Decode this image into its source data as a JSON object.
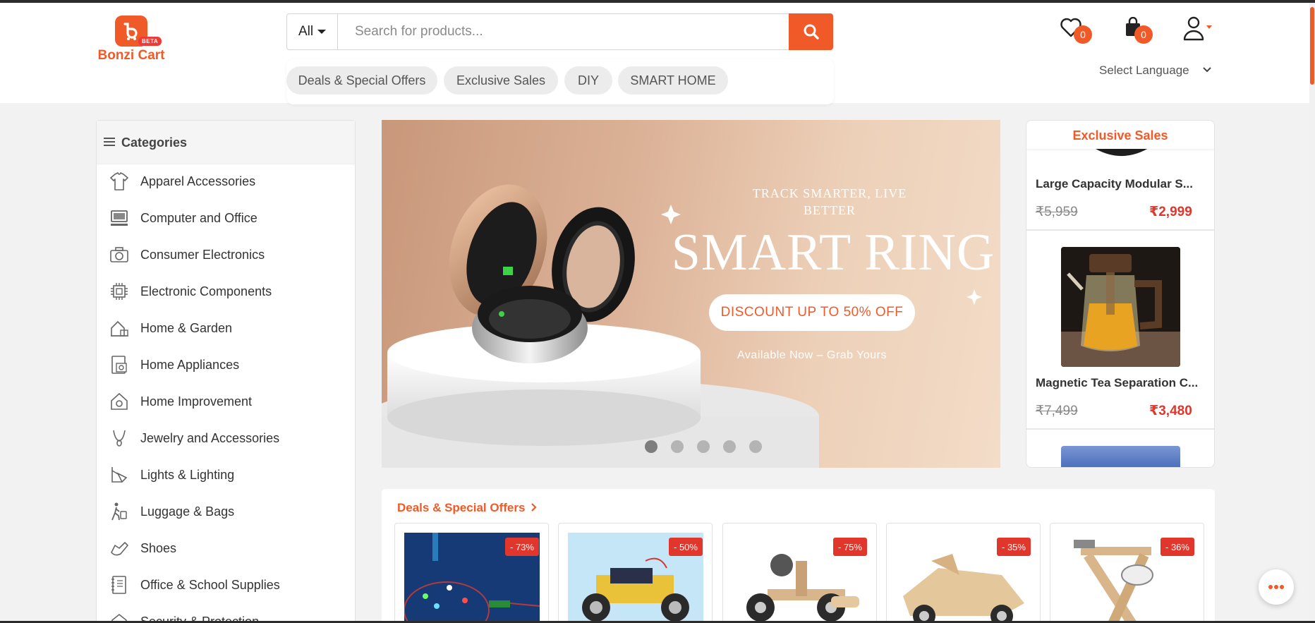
{
  "brand": {
    "name": "Bonzi Cart",
    "tag": "BETA",
    "logo_letter": "b",
    "accent": "#f05a28",
    "price_color": "#e0362c"
  },
  "search": {
    "category": "All",
    "placeholder": "Search for products..."
  },
  "quick_links": [
    "Deals & Special Offers",
    "Exclusive Sales",
    "DIY",
    "SMART HOME"
  ],
  "header": {
    "wishlist_count": "0",
    "cart_count": "0",
    "language_label": "Select Language"
  },
  "sidebar": {
    "title": "Categories",
    "items": [
      {
        "label": "Apparel Accessories",
        "icon": "shirt-icon"
      },
      {
        "label": "Computer and Office",
        "icon": "computer-icon"
      },
      {
        "label": "Consumer Electronics",
        "icon": "camera-icon"
      },
      {
        "label": "Electronic Components",
        "icon": "chip-icon"
      },
      {
        "label": "Home & Garden",
        "icon": "house-icon"
      },
      {
        "label": "Home Appliances",
        "icon": "appliance-icon"
      },
      {
        "label": "Home Improvement",
        "icon": "home-gear-icon"
      },
      {
        "label": "Jewelry and Accessories",
        "icon": "necklace-icon"
      },
      {
        "label": "Lights & Lighting",
        "icon": "lamp-icon"
      },
      {
        "label": "Luggage & Bags",
        "icon": "traveler-icon"
      },
      {
        "label": "Shoes",
        "icon": "shoe-icon"
      },
      {
        "label": "Office & School Supplies",
        "icon": "binder-icon"
      },
      {
        "label": "Security & Protection",
        "icon": "lock-icon"
      }
    ]
  },
  "banner": {
    "subtitle": "TRACK SMARTER, LIVE BETTER",
    "title": "SMART RING",
    "cta": "DISCOUNT UP TO 50% OFF",
    "footer": "Available Now – Grab Yours",
    "slide_count": 5,
    "active_slide": 1
  },
  "exclusive": {
    "title": "Exclusive Sales",
    "items": [
      {
        "name": "Large Capacity Modular S...",
        "old_price": "₹5,959",
        "price": "₹2,999"
      },
      {
        "name": "Magnetic Tea Separation C...",
        "old_price": "₹7,499",
        "price": "₹3,480"
      }
    ]
  },
  "deals": {
    "title": "Deals & Special Offers",
    "items": [
      {
        "discount": "- 73%"
      },
      {
        "discount": "- 50%"
      },
      {
        "discount": "- 75%"
      },
      {
        "discount": "- 35%"
      },
      {
        "discount": "- 36%"
      }
    ]
  }
}
